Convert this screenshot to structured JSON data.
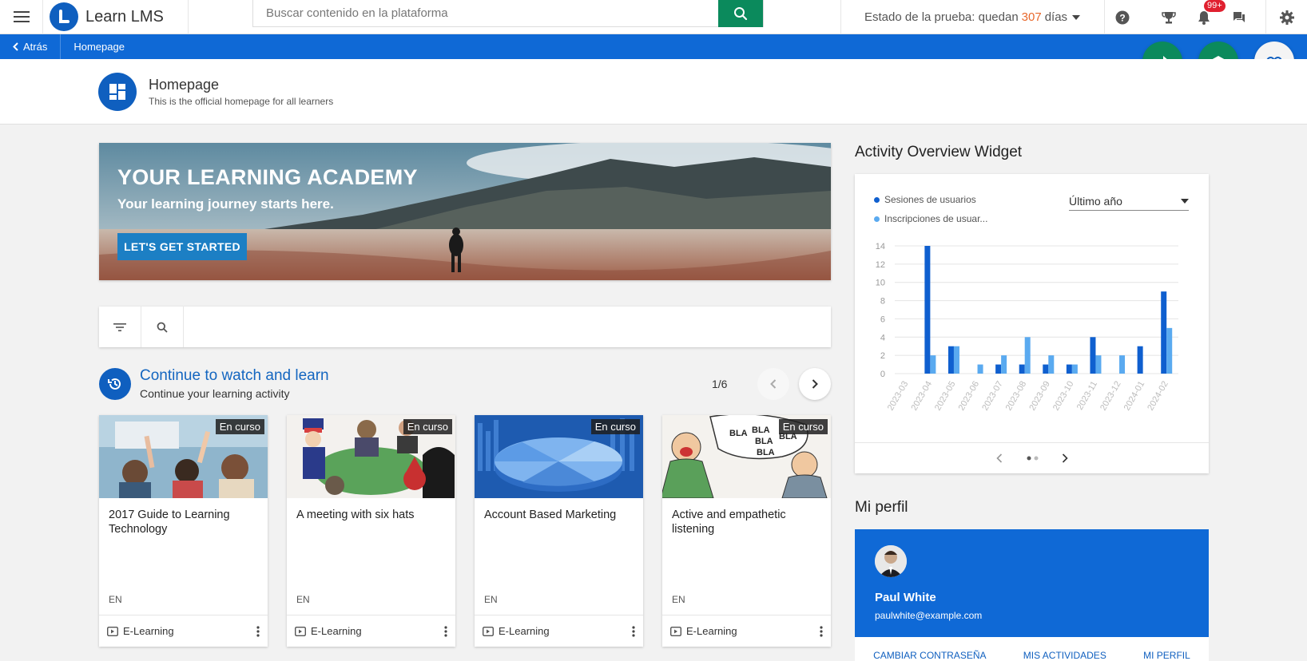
{
  "topbar": {
    "brand": "Learn LMS",
    "search_placeholder": "Buscar contenido en la plataforma",
    "trial_prefix": "Estado de la prueba: quedan",
    "trial_days": "307",
    "trial_suffix": "días",
    "notifications_badge": "99+"
  },
  "subnav": {
    "back_label": "Atrás",
    "crumb": "Homepage"
  },
  "page_header": {
    "title": "Homepage",
    "subtitle": "This is the official homepage for all learners"
  },
  "banner": {
    "title": "YOUR LEARNING ACADEMY",
    "subtitle": "Your learning journey starts here.",
    "cta": "LET'S GET STARTED"
  },
  "continue_section": {
    "title": "Continue to watch and learn",
    "subtitle": "Continue your learning activity",
    "pager": "1/6",
    "cards": [
      {
        "title": "2017 Guide to Learning Technology",
        "tag": "En curso",
        "lang": "EN",
        "type": "E-Learning"
      },
      {
        "title": "A meeting with six hats",
        "tag": "En curso",
        "lang": "EN",
        "type": "E-Learning"
      },
      {
        "title": "Account Based Marketing",
        "tag": "En curso",
        "lang": "EN",
        "type": "E-Learning"
      },
      {
        "title": "Active and empathetic listening",
        "tag": "En curso",
        "lang": "EN",
        "type": "E-Learning"
      }
    ]
  },
  "activity_widget": {
    "title": "Activity Overview Widget",
    "period": "Último año",
    "colors": {
      "sessions": "#0f5fcf",
      "enrollments": "#5aaaf0"
    }
  },
  "chart_data": {
    "type": "bar",
    "categories": [
      "2023-03",
      "2023-04",
      "2023-05",
      "2023-06",
      "2023-07",
      "2023-08",
      "2023-09",
      "2023-10",
      "2023-11",
      "2023-12",
      "2024-01",
      "2024-02"
    ],
    "series": [
      {
        "name": "Sesiones de usuarios",
        "values": [
          0,
          14,
          3,
          0,
          1,
          1,
          1,
          1,
          4,
          0,
          3,
          9
        ]
      },
      {
        "name": "Inscripciones de usuar...",
        "values": [
          0,
          2,
          3,
          1,
          2,
          4,
          2,
          1,
          2,
          2,
          0,
          5
        ]
      }
    ],
    "yticks": [
      "0",
      "2",
      "4",
      "6",
      "8",
      "10",
      "12",
      "14"
    ],
    "ylim": [
      0,
      14
    ],
    "grid": true,
    "legend": "top-left"
  },
  "profile": {
    "section_title": "Mi perfil",
    "name": "Paul White",
    "email": "paulwhite@example.com",
    "links": [
      "CAMBIAR CONTRASEÑA",
      "MIS ACTIVIDADES",
      "MI PERFIL"
    ]
  }
}
